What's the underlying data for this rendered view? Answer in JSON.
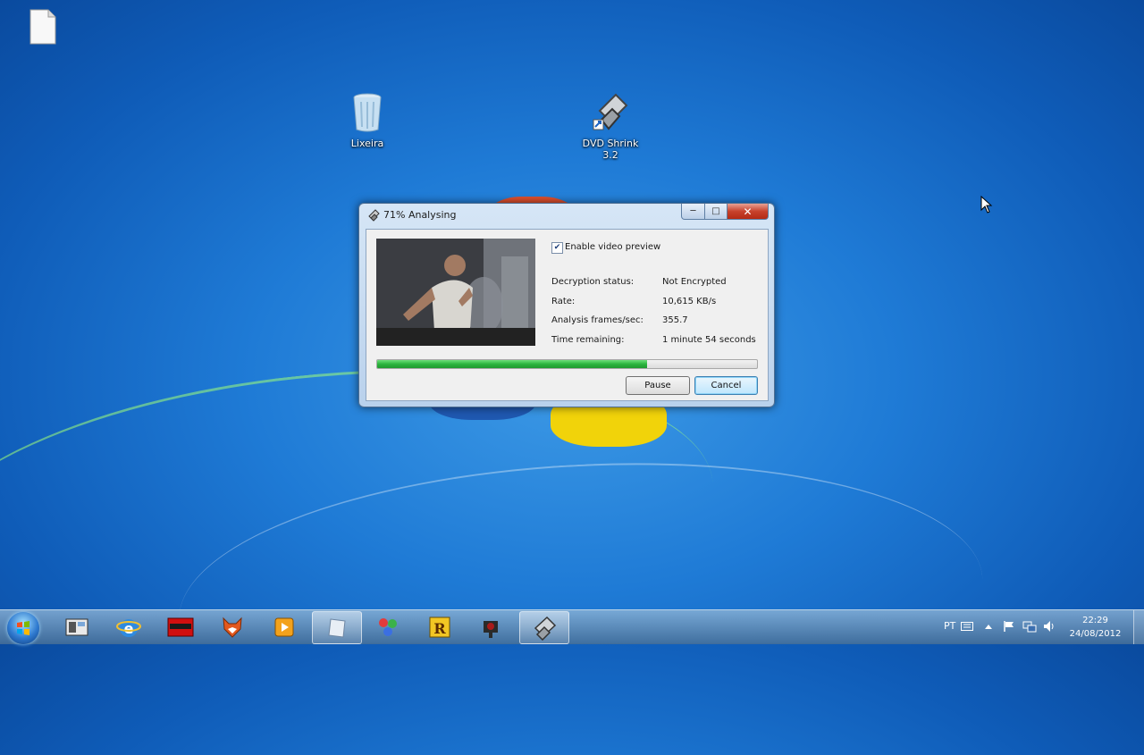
{
  "desktop": {
    "icons": [
      {
        "label": "",
        "icon": "file-icon"
      },
      {
        "label": "Lixeira",
        "icon": "recycle-bin-icon"
      },
      {
        "label": "DVD Shrink 3.2",
        "icon": "dvd-shrink-icon"
      }
    ]
  },
  "dialog": {
    "title": "71% Analysing",
    "preview_checkbox_label": "Enable video preview",
    "preview_checked": true,
    "fields": [
      {
        "label": "Decryption status:",
        "value": "Not Encrypted"
      },
      {
        "label": "Rate:",
        "value": "10,615 KB/s"
      },
      {
        "label": "Analysis frames/sec:",
        "value": "355.7"
      },
      {
        "label": "Time remaining:",
        "value": "1 minute 54 seconds"
      }
    ],
    "progress_fraction": 0.71,
    "pause_label": "Pause",
    "cancel_label": "Cancel"
  },
  "taskbar": {
    "items": [
      "start-orb-icon",
      "explorer-icon",
      "internet-explorer-icon",
      "red-app-icon",
      "fox-app-icon",
      "media-player-icon",
      "notepad-icon",
      "paint-icon",
      "r-app-icon",
      "camera-app-icon",
      "dvd-shrink-icon"
    ],
    "language": "PT",
    "time": "22:29",
    "date": "24/08/2012"
  },
  "colors": {
    "progress": "#2cb43e",
    "desktop": "#1f7bd6"
  }
}
